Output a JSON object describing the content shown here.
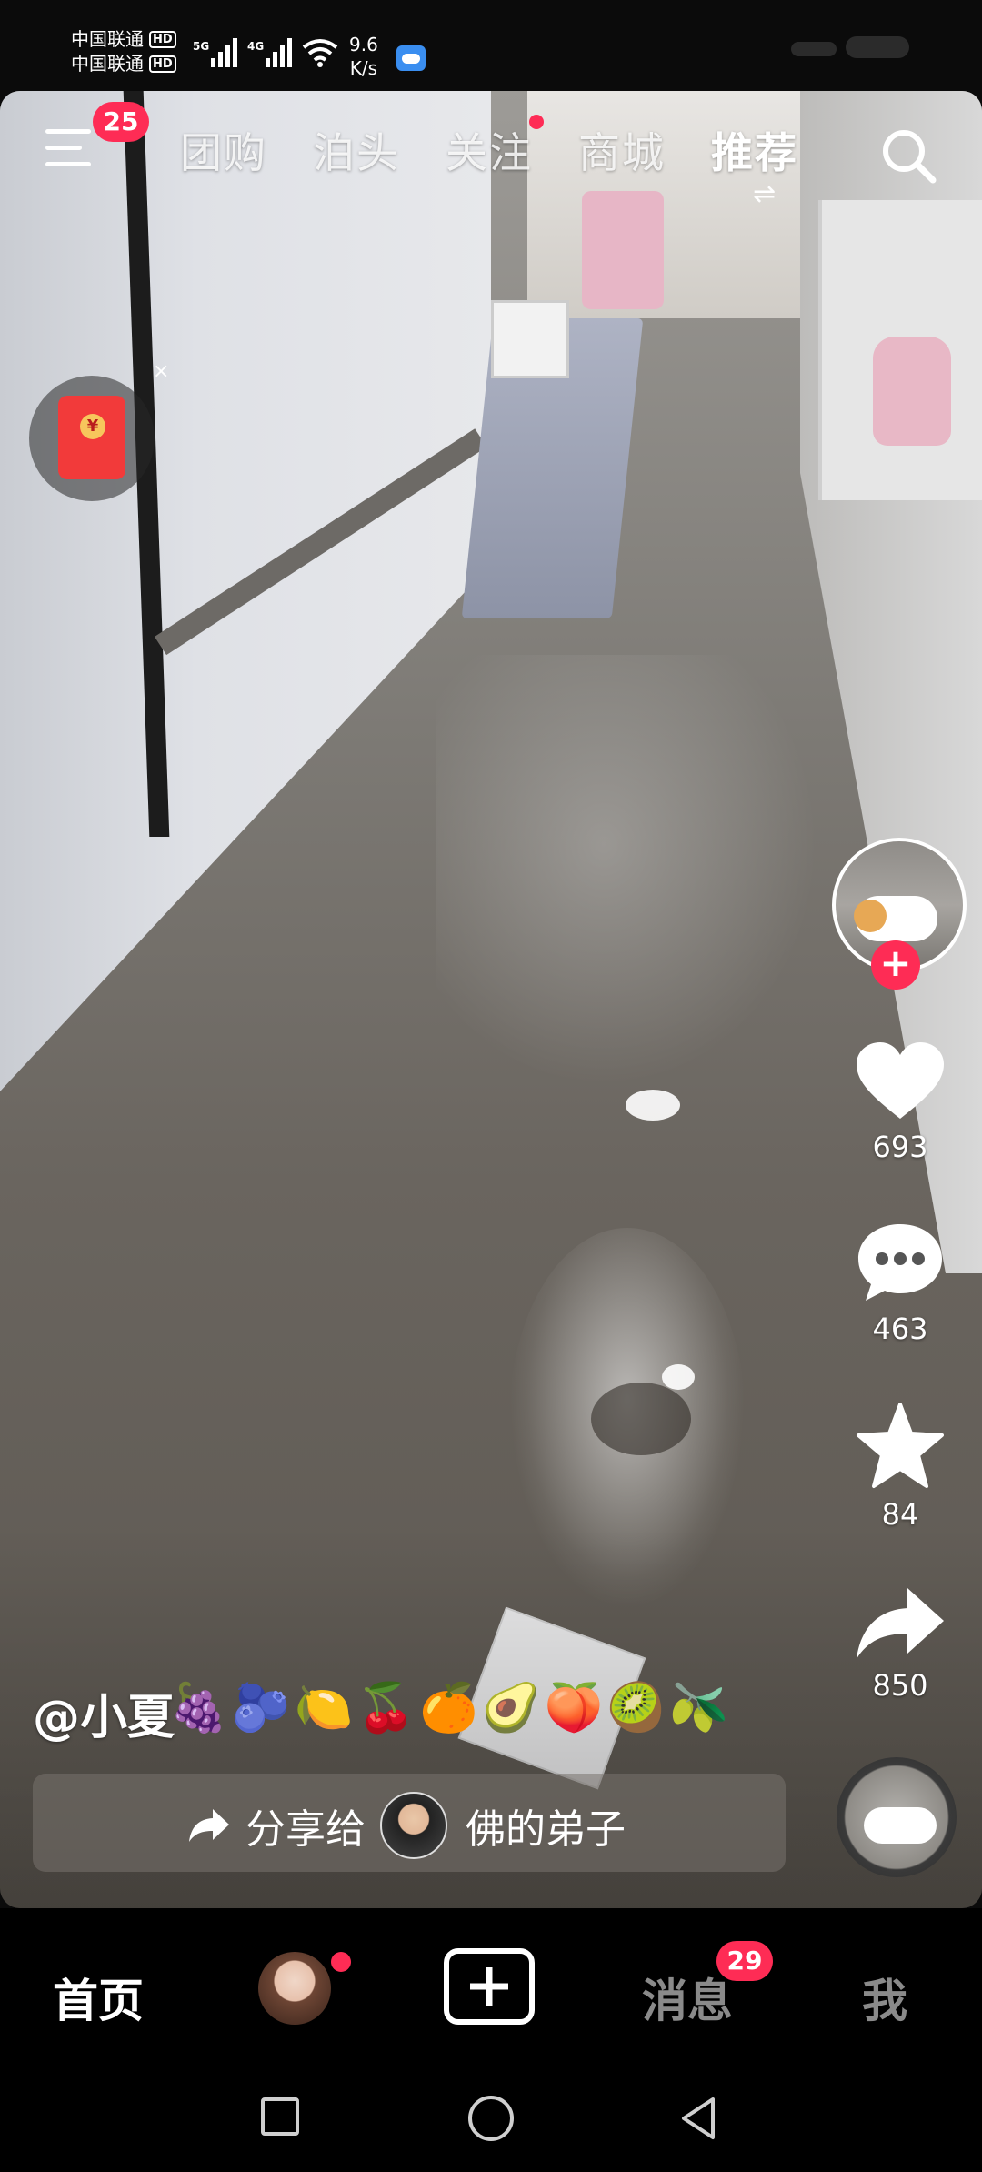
{
  "status_bar": {
    "carrier_1": "中国联通",
    "carrier_2": "中国联通",
    "hd_label": "HD",
    "net_1": "5G",
    "net_2": "4G",
    "speed_value": "9.6",
    "speed_unit": "K/s",
    "cloud_icon": "cloud-icon"
  },
  "top_nav": {
    "menu_badge": "25",
    "tabs": [
      {
        "label": "团购",
        "active": false
      },
      {
        "label": "泊头",
        "active": false
      },
      {
        "label": "关注",
        "active": false,
        "has_dot": true
      },
      {
        "label": "商城",
        "active": false
      },
      {
        "label": "推荐",
        "active": true
      }
    ],
    "search_icon": "search-icon"
  },
  "red_envelope": {
    "coin_symbol": "¥",
    "close_label": "×"
  },
  "actions": {
    "likes": "693",
    "comments": "463",
    "favorites": "84",
    "shares": "850",
    "follow_plus": "+"
  },
  "caption": {
    "username": "@小夏",
    "emojis": "🍇🫐🍋🍒🍊🥑🍑🥝🫒"
  },
  "share_bar": {
    "label": "分享给",
    "recipient": "佛的弟子"
  },
  "bottom_nav": {
    "home": "首页",
    "messages": "消息",
    "messages_badge": "29",
    "me": "我"
  },
  "colors": {
    "accent": "#fe2c55",
    "nav_bg": "#000000"
  }
}
